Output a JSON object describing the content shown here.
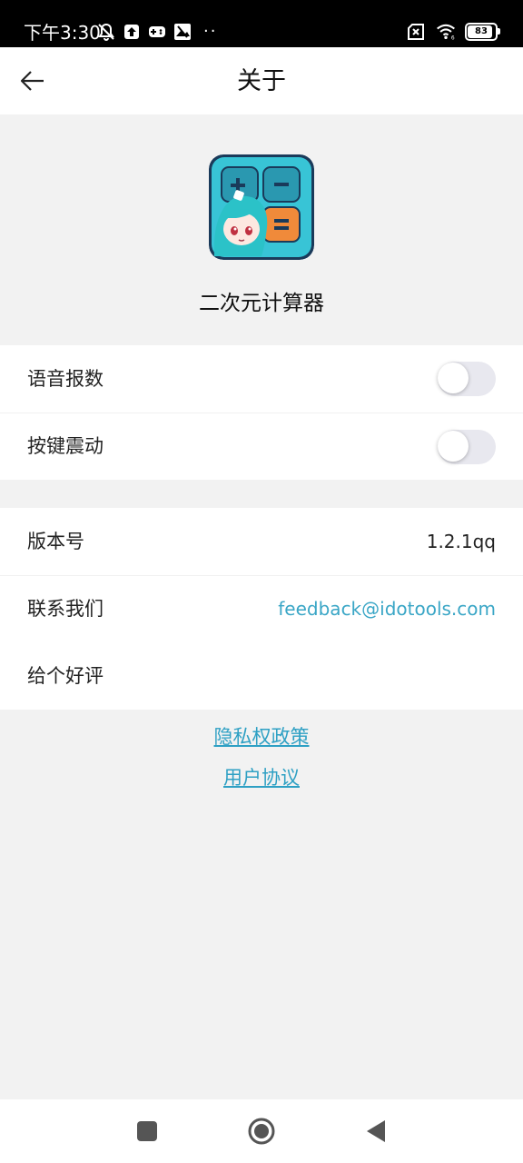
{
  "status_bar": {
    "time": "下午3:30",
    "battery_level": "83",
    "icons_left": [
      "mute-bell-icon",
      "upload-icon",
      "game-icon",
      "image-icon",
      "more-dots-icon"
    ],
    "icons_right": [
      "sim-off-icon",
      "wifi-icon",
      "battery-icon"
    ],
    "dots": "··"
  },
  "app_bar": {
    "title": "关于",
    "back_icon": "arrow-left-icon"
  },
  "app_info": {
    "name": "二次元计算器",
    "icon": "anime-calculator-app-icon"
  },
  "settings": [
    {
      "label": "语音报数",
      "type": "toggle",
      "enabled": false
    },
    {
      "label": "按键震动",
      "type": "toggle",
      "enabled": false
    }
  ],
  "info": {
    "version_label": "版本号",
    "version_value": "1.2.1qq",
    "contact_label": "联系我们",
    "contact_value": "feedback@idotools.com",
    "rate_label": "给个好评"
  },
  "links": {
    "privacy": "隐私权政策",
    "user_agreement": "用户协议"
  },
  "colors": {
    "accent": "#3aa6c6",
    "background": "#f2f2f2",
    "toggle_off": "#e8e8ef"
  },
  "nav_bar": {
    "icons": [
      "square-recents-icon",
      "circle-home-icon",
      "triangle-back-icon"
    ]
  }
}
